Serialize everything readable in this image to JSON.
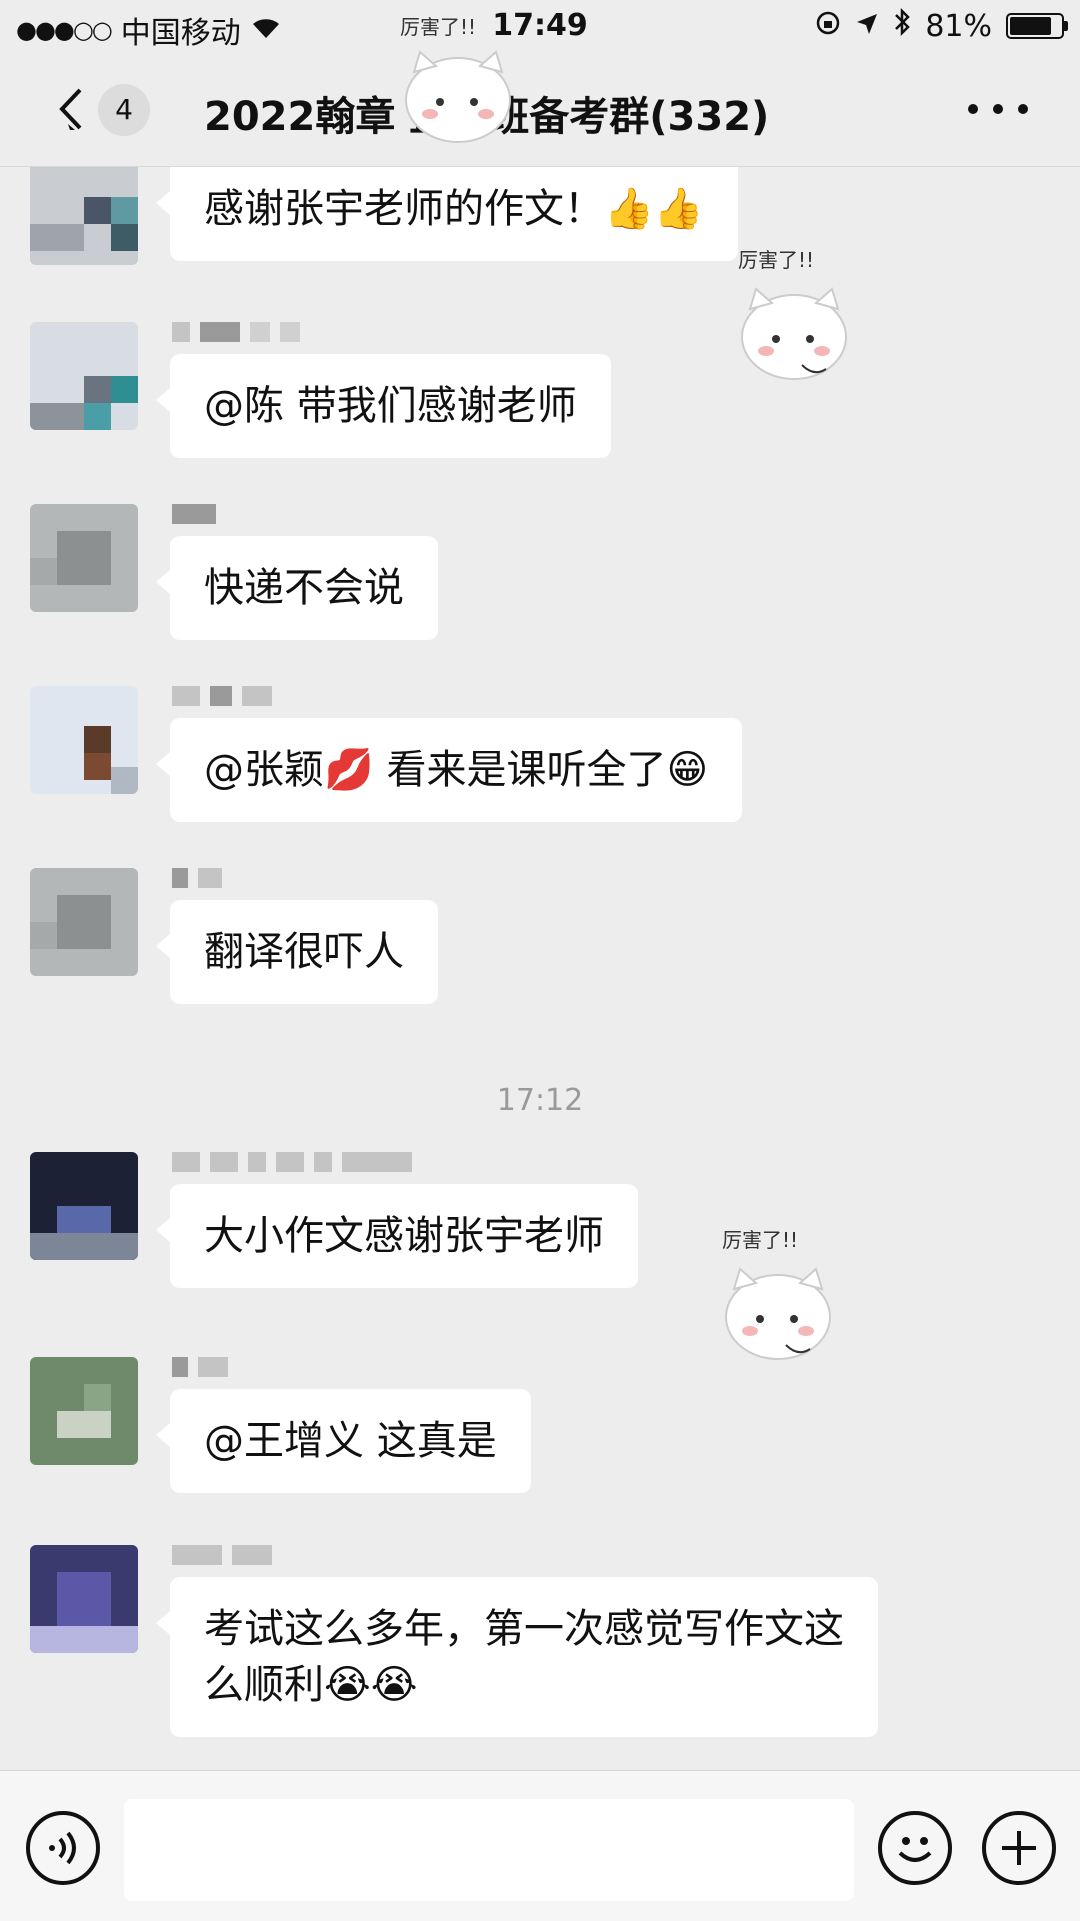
{
  "status_bar": {
    "signal": "●●●○○",
    "carrier": "中国移动",
    "time": "17:49",
    "battery": "81%",
    "battery_level": 0.81
  },
  "header": {
    "unread_count": "4",
    "title": "2022翰章   直播班备考群(332)"
  },
  "stickers": {
    "caption": "厉害了!!"
  },
  "messages": [
    {
      "text": "感谢张宇老师的作文！👍👍"
    },
    {
      "text": "@陈 带我们感谢老师"
    },
    {
      "text": "快递不会说"
    },
    {
      "text": "@张颖💋 看来是课听全了😁"
    },
    {
      "text": "翻译很吓人"
    },
    {
      "text": "大小作文感谢张宇老师"
    },
    {
      "text": "@王增义 这真是"
    },
    {
      "text": "考试这么多年，第一次感觉写作文这么顺利😭😭"
    }
  ],
  "time_divider": "17:12",
  "input": {
    "value": "",
    "placeholder": ""
  },
  "icons": {
    "back": "chevron-left-icon",
    "more": "more-dots-icon",
    "voice": "voice-icon",
    "emoji": "emoji-icon",
    "add": "plus-icon",
    "wifi": "wifi-icon",
    "location": "location-arrow-icon",
    "bluetooth": "bluetooth-icon",
    "rotation_lock": "rotation-lock-icon"
  },
  "colors": {
    "background": "#ededed",
    "bubble": "#ffffff",
    "text": "#111111",
    "divider_text": "#9a9a9a"
  }
}
